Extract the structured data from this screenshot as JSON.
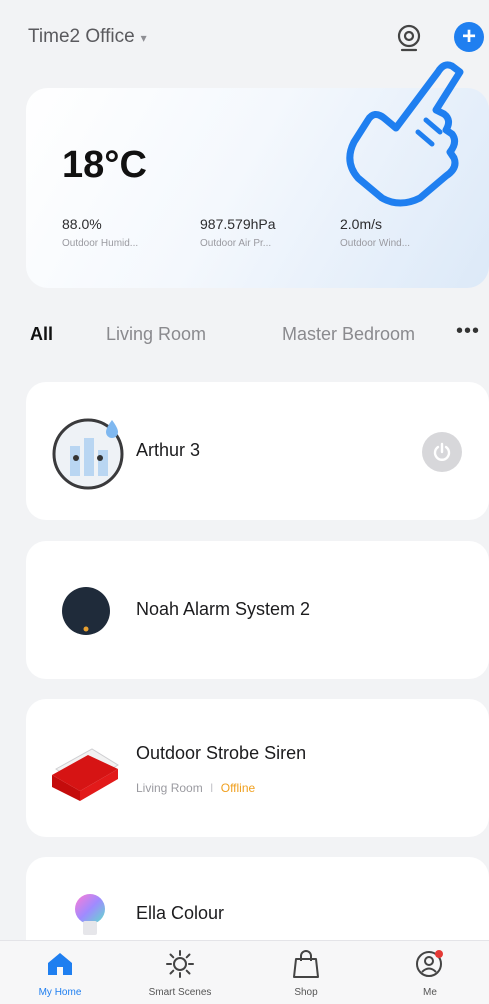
{
  "header": {
    "home_name": "Time2 Office",
    "caret": "▾",
    "add_symbol": "+"
  },
  "weather": {
    "temperature": "18°C",
    "stats": [
      {
        "value": "88.0%",
        "label": "Outdoor Humid..."
      },
      {
        "value": "987.579hPa",
        "label": "Outdoor Air Pr..."
      },
      {
        "value": "2.0m/s",
        "label": "Outdoor Wind..."
      }
    ]
  },
  "tabs": {
    "items": [
      "All",
      "Living Room",
      "Master Bedroom"
    ],
    "more": "•••"
  },
  "devices": [
    {
      "name": "Arthur 3"
    },
    {
      "name": "Noah Alarm System 2"
    },
    {
      "name": "Outdoor Strobe Siren",
      "room": "Living Room",
      "separator": "I",
      "status": "Offline"
    },
    {
      "name": "Ella Colour"
    }
  ],
  "bottom_nav": [
    {
      "label": "My Home",
      "icon": "home-icon"
    },
    {
      "label": "Smart Scenes",
      "icon": "sun-icon"
    },
    {
      "label": "Shop",
      "icon": "shopping-bag-icon"
    },
    {
      "label": "Me",
      "icon": "user-icon"
    }
  ],
  "colors": {
    "accent": "#1f7ff0",
    "offline": "#f0a020",
    "hand_stroke": "#1f7ff0"
  }
}
